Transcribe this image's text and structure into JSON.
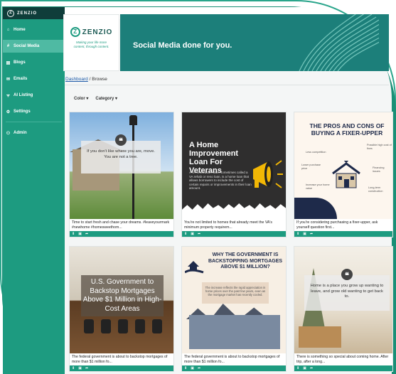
{
  "app": {
    "brand": "ZENZIO",
    "accent": "#1d9b80",
    "dark": "#0f3d3a"
  },
  "sidebar": {
    "items": [
      {
        "label": "Home",
        "icon": "home-icon"
      },
      {
        "label": "Social Media",
        "icon": "hash-icon",
        "active": true
      },
      {
        "label": "Blogs",
        "icon": "blog-icon"
      },
      {
        "label": "Emails",
        "icon": "email-icon"
      },
      {
        "label": "AI Listing",
        "icon": "broadcast-icon"
      },
      {
        "label": "Settings",
        "icon": "gear-icon"
      }
    ],
    "admin": {
      "label": "Admin",
      "icon": "admin-icon"
    }
  },
  "banner": {
    "logo_text": "ZENZIO",
    "tagline": "Making your life more content, through content.",
    "title": "Social Media done for you."
  },
  "breadcrumb": {
    "link": "Dashboard",
    "separator": "/",
    "current": "Browse"
  },
  "filters": {
    "color": "Color",
    "category": "Category"
  },
  "cards": [
    {
      "quote": "If you don't like where you are, move. You are not a tree.",
      "caption": "Time to start fresh and chase your dreams. #leaveyourmark #newhome #homesweethom..."
    },
    {
      "title": "A Home Improvement Loan For Veterans",
      "body": "A VA renovation loan, sometimes called a VA rehab or reno loan, is a home loan that allows borrowers to include the cost of certain repairs or improvements in their loan amount.",
      "caption": "You're not limited to homes that already meet the VA's minimum property requirem..."
    },
    {
      "title": "THE PROS AND CONS OF BUYING A FIXER-UPPER",
      "labels_left": [
        "Less competition",
        "Lower purchase price",
        "Increase your home value"
      ],
      "labels_right": [
        "Possible high cost of fixes",
        "Financing issues",
        "Long-term construction"
      ],
      "caption": "If you're considering purchasing a fixer-upper, ask yourself question first..."
    },
    {
      "title": "U.S. Government to Backstop Mortgages Above $1 Million in High-Cost Areas",
      "caption": "The federal government is about to backstop mortgages of more than $1 million fo..."
    },
    {
      "title": "WHY THE GOVERNMENT IS BACKSTOPPING MORTGAGES ABOVE $1 MILLION?",
      "body": "The increase reflects the rapid appreciation in home prices over the past few years, even as the mortgage market has recently cooled.",
      "caption": "The federal government is about to backstop mortgages of more than $1 million fo..."
    },
    {
      "quote": "Home is a place you grow up wanting to leave, and grow old wanting to get back to.",
      "caption": "There is something so special about coming home. After trip, after a long..."
    }
  ],
  "card_actions": {
    "download_icon": "download-icon",
    "save_icon": "save-icon",
    "share_icon": "share-icon"
  }
}
